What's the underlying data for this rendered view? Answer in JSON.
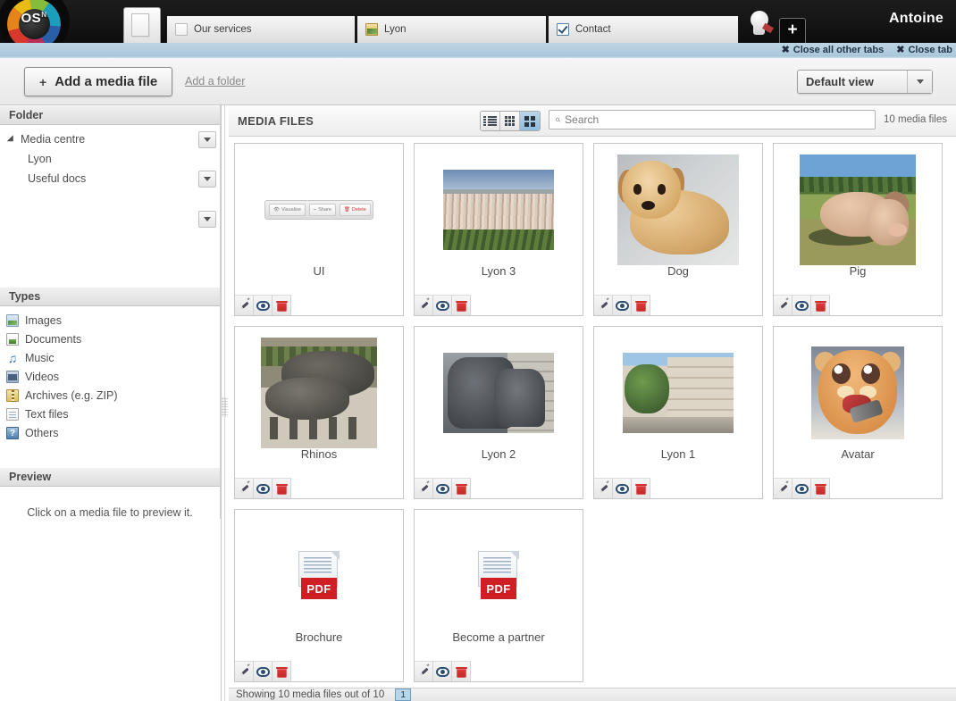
{
  "browser": {
    "logo_text": "OS",
    "logo_sup": "N",
    "user_name": "Antoine",
    "home_tab_name": "home-tab",
    "new_tab_label": "+",
    "tabs": [
      {
        "label": "Our services",
        "icon": "page-icon"
      },
      {
        "label": "Lyon",
        "icon": "image-icon"
      },
      {
        "label": "Contact",
        "icon": "checkbox-icon"
      }
    ],
    "tab_actions": [
      {
        "label": "Close all other tabs",
        "icon": "close-icon"
      },
      {
        "label": "Close tab",
        "icon": "close-icon"
      }
    ]
  },
  "toolbar": {
    "add_media_plus": "+",
    "add_media_label": "Add a media file",
    "add_folder_label": "Add a folder",
    "view_select_value": "Default view"
  },
  "sidebar": {
    "folder_section": {
      "title": "Folder",
      "items": [
        {
          "label": "Media centre",
          "level": 0,
          "expanded": true
        },
        {
          "label": "Lyon",
          "level": 1,
          "expanded": false
        },
        {
          "label": "Useful docs",
          "level": 1,
          "expanded": false
        }
      ]
    },
    "types_section": {
      "title": "Types",
      "items": [
        {
          "label": "Images",
          "icon": "images-icon"
        },
        {
          "label": "Documents",
          "icon": "documents-icon"
        },
        {
          "label": "Music",
          "icon": "music-icon"
        },
        {
          "label": "Videos",
          "icon": "videos-icon"
        },
        {
          "label": "Archives (e.g. ZIP)",
          "icon": "archive-icon"
        },
        {
          "label": "Text files",
          "icon": "text-file-icon"
        },
        {
          "label": "Others",
          "icon": "other-file-icon"
        }
      ]
    },
    "preview_section": {
      "title": "Preview",
      "empty_message": "Click on a media file to preview it."
    }
  },
  "main": {
    "title": "MEDIA FILES",
    "view_modes": [
      {
        "name": "list-view",
        "active": false
      },
      {
        "name": "small-grid-view",
        "active": false
      },
      {
        "name": "large-grid-view",
        "active": true
      }
    ],
    "search_placeholder": "Search",
    "search_value": "",
    "count_label": "10 media files",
    "card_actions": [
      {
        "name": "edit-icon",
        "title": "Edit"
      },
      {
        "name": "view-icon",
        "title": "View"
      },
      {
        "name": "delete-icon",
        "title": "Delete"
      }
    ],
    "ui_thumb_buttons": [
      {
        "label": "Visualise",
        "kind": "normal"
      },
      {
        "label": "Share",
        "kind": "normal"
      },
      {
        "label": "Delete",
        "kind": "danger"
      }
    ],
    "pdf_badge": "PDF",
    "rows": [
      [
        {
          "name": "UI",
          "thumb": "ui-mockup"
        },
        {
          "name": "Lyon 3",
          "thumb": "lyon3-photo"
        },
        {
          "name": "Dog",
          "thumb": "dog-photo"
        },
        {
          "name": "Pig",
          "thumb": "pig-photo"
        }
      ],
      [
        {
          "name": "Rhinos",
          "thumb": "rhinos-photo"
        },
        {
          "name": "Lyon 2",
          "thumb": "lyon2-photo"
        },
        {
          "name": "Lyon 1",
          "thumb": "lyon1-photo"
        },
        {
          "name": "Avatar",
          "thumb": "avatar-image"
        }
      ],
      [
        {
          "name": "Brochure",
          "thumb": "pdf-icon"
        },
        {
          "name": "Become a partner",
          "thumb": "pdf-icon"
        }
      ]
    ]
  },
  "footer": {
    "status": "Showing 10 media files out of 10",
    "page_current": "1"
  },
  "colors": {
    "accent_blue": "#8fbcdc",
    "danger_red": "#cf1f24",
    "topbar_black": "#141414",
    "subbar_blue": "#a9c6da"
  }
}
